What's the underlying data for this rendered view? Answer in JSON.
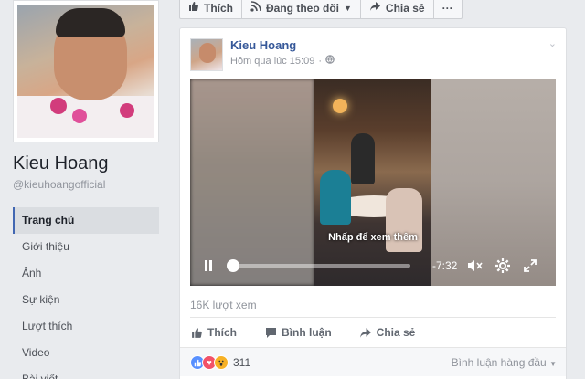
{
  "action_bar": {
    "like_label": "Thích",
    "follow_label": "Đang theo dõi",
    "share_label": "Chia sẻ",
    "more_label": "···"
  },
  "profile": {
    "name": "Kieu Hoang",
    "handle": "@kieuhoangofficial"
  },
  "left_nav": {
    "items": [
      {
        "label": "Trang chủ",
        "active": true
      },
      {
        "label": "Giới thiệu",
        "active": false
      },
      {
        "label": "Ảnh",
        "active": false
      },
      {
        "label": "Sự kiện",
        "active": false
      },
      {
        "label": "Lượt thích",
        "active": false
      },
      {
        "label": "Video",
        "active": false
      },
      {
        "label": "Bài viết",
        "active": false
      }
    ]
  },
  "post": {
    "author": "Kieu Hoang",
    "timestamp": "Hôm qua lúc 15:09",
    "video": {
      "hint": "Nhấp để xem thêm",
      "time_remaining": "-7:32",
      "progress": 0.0
    },
    "views": "16K lượt xem",
    "actions": {
      "like": "Thích",
      "comment": "Bình luận",
      "share": "Chia sẻ"
    },
    "reactions": {
      "count": "311",
      "types": [
        "like",
        "love",
        "wow"
      ]
    },
    "sort_label": "Bình luận hàng đầu"
  },
  "colors": {
    "link_blue": "#365899",
    "accent": "#4267b2",
    "background": "#e9ebee"
  }
}
